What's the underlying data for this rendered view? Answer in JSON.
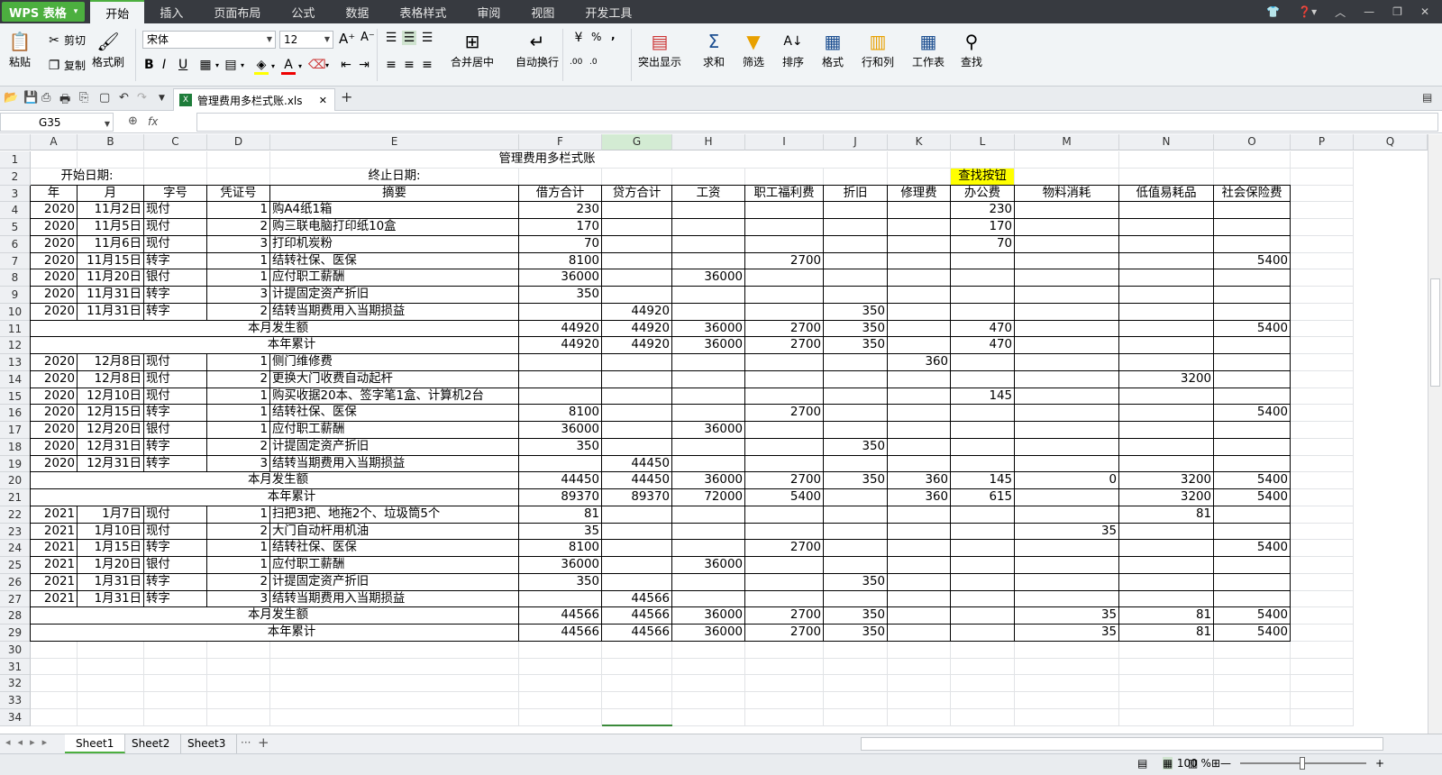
{
  "app": {
    "logo": "WPS 表格",
    "logo_arrow": "▾"
  },
  "menu": [
    "开始",
    "插入",
    "页面布局",
    "公式",
    "数据",
    "表格样式",
    "审阅",
    "视图",
    "开发工具"
  ],
  "window_controls": [
    "👕",
    "❓▾",
    "︿",
    "—",
    "❐",
    "✕"
  ],
  "ribbon": {
    "paste": "粘贴",
    "cut": "剪切",
    "copy": "复制",
    "format_painter": "格式刷",
    "font_name": "宋体",
    "font_size": "12",
    "merge_center": "合并居中",
    "wrap": "自动换行",
    "highlight": "突出显示",
    "sum": "求和",
    "filter": "筛选",
    "sort": "排序",
    "format": "格式",
    "row_col": "行和列",
    "sheet": "工作表",
    "find": "查找",
    "bold": "B",
    "italic": "I",
    "underline": "U",
    "percent": "%",
    "comma": ","
  },
  "doc_tab": {
    "name": "管理费用多栏式账.xls",
    "close": "✕",
    "new": "+"
  },
  "formula": {
    "name_box": "G35",
    "fx": "fx",
    "value": ""
  },
  "columns": [
    "A",
    "B",
    "C",
    "D",
    "E",
    "F",
    "G",
    "H",
    "I",
    "J",
    "K",
    "L",
    "M",
    "N",
    "O",
    "P",
    "Q"
  ],
  "rows": [
    "1",
    "2",
    "3",
    "4",
    "5",
    "6",
    "7",
    "8",
    "9",
    "10",
    "11",
    "12",
    "13",
    "14",
    "15",
    "16",
    "17",
    "18",
    "19",
    "20",
    "21",
    "22",
    "23",
    "24",
    "25",
    "26",
    "27",
    "28",
    "29",
    "30",
    "31",
    "32",
    "33",
    "34"
  ],
  "sheet": {
    "title": "管理费用多栏式账",
    "start_label": "开始日期:",
    "end_label": "终止日期:",
    "find_button": "查找按钮",
    "headers": [
      "年",
      "月",
      "字号",
      "凭证号",
      "摘要",
      "借方合计",
      "贷方合计",
      "工资",
      "职工福利费",
      "折旧",
      "修理费",
      "办公费",
      "物料消耗",
      "低值易耗品",
      "社会保险费"
    ],
    "data": [
      [
        "2020",
        "11月2日",
        "现付",
        "1",
        "购A4纸1箱",
        "230",
        "",
        "",
        "",
        "",
        "",
        "230",
        "",
        "",
        ""
      ],
      [
        "2020",
        "11月5日",
        "现付",
        "2",
        "购三联电脑打印纸10盒",
        "170",
        "",
        "",
        "",
        "",
        "",
        "170",
        "",
        "",
        ""
      ],
      [
        "2020",
        "11月6日",
        "现付",
        "3",
        "打印机炭粉",
        "70",
        "",
        "",
        "",
        "",
        "",
        "70",
        "",
        "",
        ""
      ],
      [
        "2020",
        "11月15日",
        "转字",
        "1",
        "结转社保、医保",
        "8100",
        "",
        "",
        "2700",
        "",
        "",
        "",
        "",
        "",
        "5400"
      ],
      [
        "2020",
        "11月20日",
        "银付",
        "1",
        "应付职工薪酬",
        "36000",
        "",
        "36000",
        "",
        "",
        "",
        "",
        "",
        "",
        ""
      ],
      [
        "2020",
        "11月31日",
        "转字",
        "3",
        "计提固定资产折旧",
        "350",
        "",
        "",
        "",
        "",
        "",
        "",
        "",
        "",
        ""
      ],
      [
        "2020",
        "11月31日",
        "转字",
        "2",
        "结转当期费用入当期损益",
        "",
        "44920",
        "",
        "",
        "350",
        "",
        "",
        "",
        "",
        ""
      ],
      [
        "",
        "",
        "",
        "",
        "本月发生额",
        "44920",
        "44920",
        "36000",
        "2700",
        "350",
        "",
        "470",
        "",
        "",
        "5400"
      ],
      [
        "",
        "",
        "",
        "",
        "本年累计",
        "44920",
        "44920",
        "36000",
        "2700",
        "350",
        "",
        "470",
        "",
        "",
        ""
      ],
      [
        "2020",
        "12月8日",
        "现付",
        "1",
        "侧门维修费",
        "",
        "",
        "",
        "",
        "",
        "360",
        "",
        "",
        "",
        ""
      ],
      [
        "2020",
        "12月8日",
        "现付",
        "2",
        "更换大门收费自动起杆",
        "",
        "",
        "",
        "",
        "",
        "",
        "",
        "",
        "3200",
        ""
      ],
      [
        "2020",
        "12月10日",
        "现付",
        "1",
        "购买收据20本、签字笔1盒、计算机2台",
        "",
        "",
        "",
        "",
        "",
        "",
        "145",
        "",
        "",
        ""
      ],
      [
        "2020",
        "12月15日",
        "转字",
        "1",
        "结转社保、医保",
        "8100",
        "",
        "",
        "2700",
        "",
        "",
        "",
        "",
        "",
        "5400"
      ],
      [
        "2020",
        "12月20日",
        "银付",
        "1",
        "应付职工薪酬",
        "36000",
        "",
        "36000",
        "",
        "",
        "",
        "",
        "",
        "",
        ""
      ],
      [
        "2020",
        "12月31日",
        "转字",
        "2",
        "计提固定资产折旧",
        "350",
        "",
        "",
        "",
        "350",
        "",
        "",
        "",
        "",
        ""
      ],
      [
        "2020",
        "12月31日",
        "转字",
        "3",
        "结转当期费用入当期损益",
        "",
        "44450",
        "",
        "",
        "",
        "",
        "",
        "",
        "",
        ""
      ],
      [
        "",
        "",
        "",
        "",
        "本月发生额",
        "44450",
        "44450",
        "36000",
        "2700",
        "350",
        "360",
        "145",
        "0",
        "3200",
        "5400"
      ],
      [
        "",
        "",
        "",
        "",
        "本年累计",
        "89370",
        "89370",
        "72000",
        "5400",
        "",
        "360",
        "615",
        "",
        "3200",
        "5400"
      ],
      [
        "2021",
        "1月7日",
        "现付",
        "1",
        "扫把3把、地拖2个、垃圾筒5个",
        "81",
        "",
        "",
        "",
        "",
        "",
        "",
        "",
        "81",
        ""
      ],
      [
        "2021",
        "1月10日",
        "现付",
        "2",
        "大门自动杆用机油",
        "35",
        "",
        "",
        "",
        "",
        "",
        "",
        "35",
        "",
        ""
      ],
      [
        "2021",
        "1月15日",
        "转字",
        "1",
        "结转社保、医保",
        "8100",
        "",
        "",
        "2700",
        "",
        "",
        "",
        "",
        "",
        "5400"
      ],
      [
        "2021",
        "1月20日",
        "银付",
        "1",
        "应付职工薪酬",
        "36000",
        "",
        "36000",
        "",
        "",
        "",
        "",
        "",
        "",
        ""
      ],
      [
        "2021",
        "1月31日",
        "转字",
        "2",
        "计提固定资产折旧",
        "350",
        "",
        "",
        "",
        "350",
        "",
        "",
        "",
        "",
        ""
      ],
      [
        "2021",
        "1月31日",
        "转字",
        "3",
        "结转当期费用入当期损益",
        "",
        "44566",
        "",
        "",
        "",
        "",
        "",
        "",
        "",
        ""
      ],
      [
        "",
        "",
        "",
        "",
        "本月发生额",
        "44566",
        "44566",
        "36000",
        "2700",
        "350",
        "",
        "",
        "35",
        "81",
        "5400"
      ],
      [
        "",
        "",
        "",
        "",
        "本年累计",
        "44566",
        "44566",
        "36000",
        "2700",
        "350",
        "",
        "",
        "35",
        "81",
        "5400"
      ]
    ]
  },
  "sheet_tabs": [
    "Sheet1",
    "Sheet2",
    "Sheet3"
  ],
  "sheet_nav": [
    "◂",
    "◂",
    "▸",
    "▸"
  ],
  "sheet_more": "···",
  "sheet_add": "+",
  "status": {
    "zoom": "100 %",
    "minus": "—",
    "plus": "+"
  }
}
